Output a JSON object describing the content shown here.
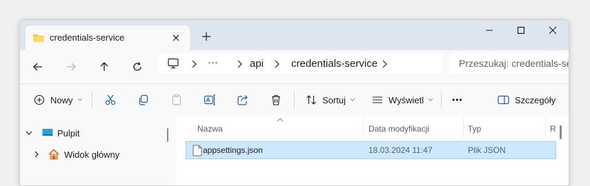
{
  "window": {
    "tab_title": "credentials-service",
    "new_tab_glyph": "+"
  },
  "address_bar": {
    "ellipsis": "···",
    "crumbs": [
      "api",
      "credentials-service"
    ],
    "search_placeholder": "Przeszukaj: credentials-service"
  },
  "toolbar": {
    "new_label": "Nowy",
    "sort_label": "Sortuj",
    "view_label": "Wyświetl",
    "more_glyph": "•••",
    "details_label": "Szczegóły"
  },
  "nav_pane": {
    "items": [
      {
        "label": "Pulpit",
        "icon": "desktop-icon",
        "expanded": true
      },
      {
        "label": "Widok główny",
        "icon": "home-icon",
        "expanded": false
      }
    ]
  },
  "file_list": {
    "columns": [
      "Nazwa",
      "Data modyfikacji",
      "Typ",
      "R"
    ],
    "rows": [
      {
        "name": "appsettings.json",
        "modified": "18.03.2024 11:47",
        "type": "Plik JSON",
        "selected": true
      }
    ]
  },
  "colors": {
    "titlebar": "#dde6ee",
    "selection": "#cce8ff",
    "folder": "#f4c542",
    "accent": "#0067c0"
  }
}
